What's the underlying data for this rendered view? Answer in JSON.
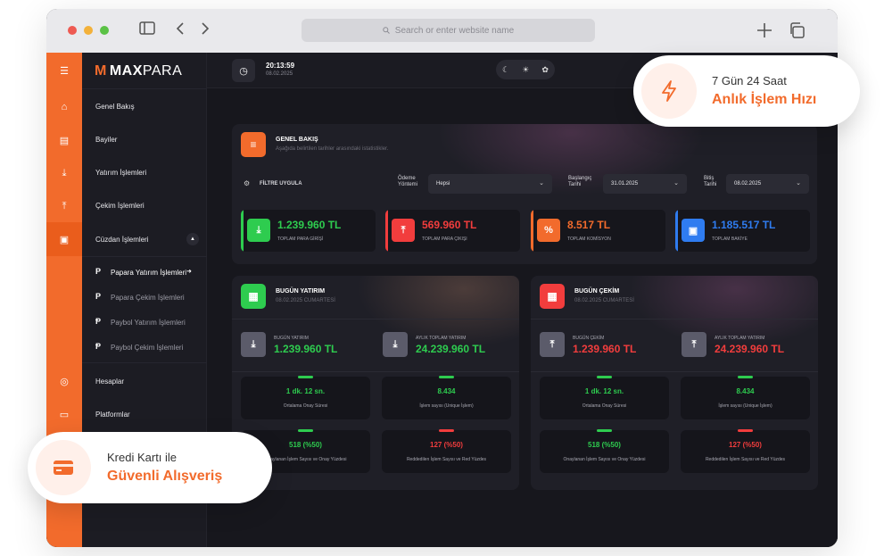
{
  "browser": {
    "address_placeholder": "Search or enter website name"
  },
  "app": {
    "logo_m": "M",
    "logo_bold": "MAX",
    "logo_light": "PARA"
  },
  "topbar": {
    "time": "20:13:59",
    "date": "08.02.2025"
  },
  "sidebar": {
    "items": [
      {
        "label": "Genel Bakış"
      },
      {
        "label": "Bayiler"
      },
      {
        "label": "Yatırım İşlemleri"
      },
      {
        "label": "Çekim İşlemleri"
      },
      {
        "label": "Cüzdan İşlemleri"
      },
      {
        "label": "Hesaplar"
      },
      {
        "label": "Platformlar"
      }
    ],
    "subitems": [
      {
        "label": "Papara Yatırım İşlemleri",
        "active": true
      },
      {
        "label": "Papara Çekim İşlemleri"
      },
      {
        "label": "Paybol Yatırım İşlemleri"
      },
      {
        "label": "Paybol Çekim İşlemleri"
      }
    ]
  },
  "overview": {
    "title": "GENEL BAKIŞ",
    "subtitle": "Aşağıda belirtilen tarihler arasındaki istatistikler.",
    "filter_label": "FİLTRE UYGULA",
    "payment_label_1": "Ödeme",
    "payment_label_2": "Yöntemi",
    "payment_value": "Hepsi",
    "start_label_1": "Başlangıç",
    "start_label_2": "Tarihi",
    "start_value": "31.01.2025",
    "end_label_1": "Bitiş",
    "end_label_2": "Tarihi",
    "end_value": "08.02.2025",
    "stats": [
      {
        "value": "1.239.960 TL",
        "label": "TOPLAM PARA GİRİŞİ",
        "color": "#2ecc4f"
      },
      {
        "value": "569.960 TL",
        "label": "TOPLAM PARA ÇIKIŞI",
        "color": "#f23d3d"
      },
      {
        "value": "8.517 TL",
        "label": "TOPLAM KOMİSYON",
        "color": "#f26b2c"
      },
      {
        "value": "1.185.517 TL",
        "label": "TOPLAM BAKİYE",
        "color": "#2f7cf0"
      }
    ]
  },
  "deposit": {
    "title": "BUGÜN YATIRIM",
    "date": "08.02.2025 CUMARTESİ",
    "today_label": "BUGÜN YATIRIM",
    "today_value": "1.239.960 TL",
    "monthly_label": "AYLIK TOPLAM YATIRIM",
    "monthly_value": "24.239.960 TL",
    "metrics": [
      {
        "value": "1 dk. 12 sn.",
        "label": "Ortalama Onay Süresi"
      },
      {
        "value": "8.434",
        "label": "İşlem sayısı (Unique İşlem)"
      },
      {
        "value": "518 (%50)",
        "label": "Onaylanan İşlem Sayısı ve Onay Yüzdesi"
      },
      {
        "value": "127 (%50)",
        "label": "Reddedilen İşlem Sayısı ve Red Yüzdes"
      }
    ]
  },
  "withdraw": {
    "title": "BUGÜN ÇEKİM",
    "date": "08.02.2025 CUMARTESİ",
    "today_label": "BUGÜN ÇEKİM",
    "today_value": "1.239.960 TL",
    "monthly_label": "AYLIK TOPLAM YATIRIM",
    "monthly_value": "24.239.960 TL",
    "metrics": [
      {
        "value": "1 dk. 12 sn.",
        "label": "Ortalama Onay Süresi"
      },
      {
        "value": "8.434",
        "label": "İşlem sayısı (Unique İşlem)"
      },
      {
        "value": "518 (%50)",
        "label": "Onaylanan İşlem Sayısı ve Onay Yüzdesi"
      },
      {
        "value": "127 (%50)",
        "label": "Reddedilen İşlem Sayısı ve Red Yüzdes"
      }
    ]
  },
  "badges": {
    "speed_top": "7 Gün 24 Saat",
    "speed_bottom": "Anlık İşlem Hızı",
    "card_top": "Kredi Kartı ile",
    "card_bottom": "Güvenli Alışveriş"
  },
  "colors": {
    "accent": "#f26b2c",
    "green": "#2ecc4f",
    "red": "#f23d3d",
    "blue": "#2f7cf0"
  }
}
